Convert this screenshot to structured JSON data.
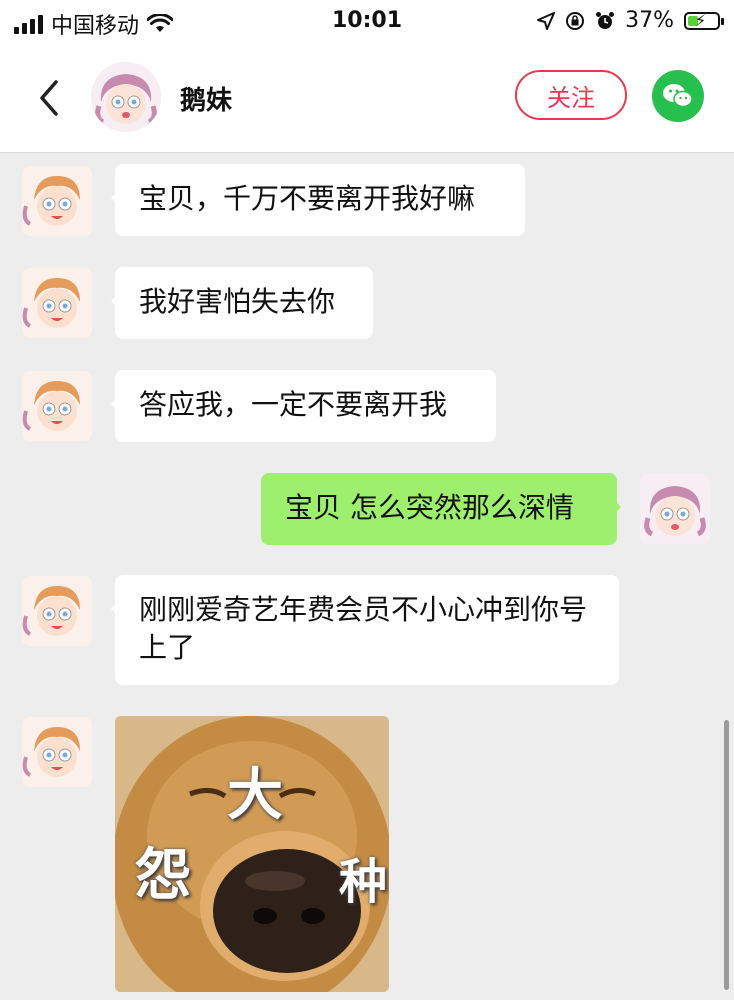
{
  "status_bar": {
    "carrier": "中国移动",
    "time": "10:01",
    "battery_percent": "37%",
    "battery_level": 0.37
  },
  "header": {
    "contact_name": "鹅妹",
    "follow_label": "关注"
  },
  "messages": [
    {
      "from": "them",
      "text": "宝贝，千万不要离开我好嘛"
    },
    {
      "from": "them",
      "text": "我好害怕失去你"
    },
    {
      "from": "them",
      "text": "答应我，一定不要离开我"
    },
    {
      "from": "me",
      "text": "宝贝 怎么突然那么深情"
    },
    {
      "from": "them",
      "text": "刚刚爱奇艺年费会员不小心冲到你号上了"
    },
    {
      "from": "them",
      "type": "sticker",
      "sticker_text": [
        "大",
        "怨",
        "种"
      ]
    }
  ],
  "icons": {
    "back": "chevron-left-icon",
    "wechat": "wechat-icon",
    "wifi": "wifi-icon",
    "location": "location-arrow-icon",
    "alarm": "alarm-clock-icon"
  },
  "colors": {
    "follow_red": "#e43c4f",
    "my_bubble": "#9def6d",
    "wechat_green": "#27c04f"
  }
}
